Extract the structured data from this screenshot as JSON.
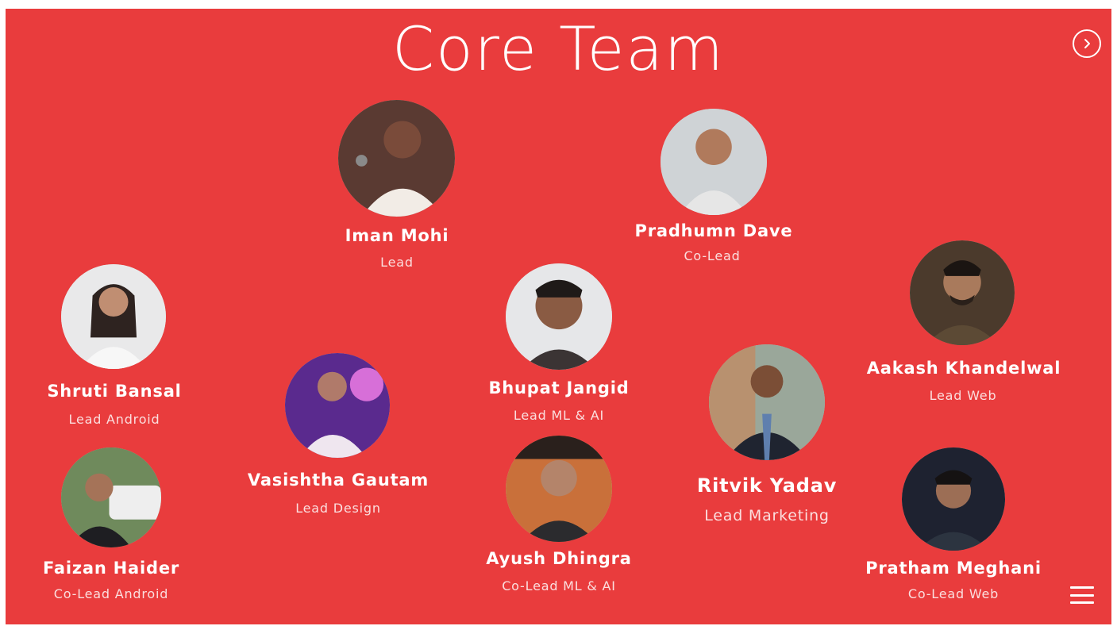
{
  "slide": {
    "title": "Core Team",
    "background_color": "#E93C3D",
    "next_icon": "chevron-right-icon",
    "menu_icon": "hamburger-menu-icon"
  },
  "members": [
    {
      "name": "Iman Mohi",
      "role": "Lead",
      "photo": "photo-woman-with-microphone"
    },
    {
      "name": "Pradhumn Dave",
      "role": "Co-Lead",
      "photo": "photo-man-light-shirt"
    },
    {
      "name": "Shruti Bansal",
      "role": "Lead Android",
      "photo": "photo-woman-white-shirt"
    },
    {
      "name": "Bhupat Jangid",
      "role": "Lead ML & AI",
      "photo": "photo-man-portrait"
    },
    {
      "name": "Aakash Khandelwal",
      "role": "Lead Web",
      "photo": "photo-man-glasses-beard"
    },
    {
      "name": "Vasishtha Gautam",
      "role": "Lead Design",
      "photo": "photo-man-purple-lights"
    },
    {
      "name": "Ritvik Yadav",
      "role": "Lead Marketing",
      "photo": "photo-man-suit"
    },
    {
      "name": "Faizan Haider",
      "role": "Co-Lead Android",
      "photo": "photo-man-by-car"
    },
    {
      "name": "Ayush Dhingra",
      "role": "Co-Lead ML & AI",
      "photo": "photo-man-glasses"
    },
    {
      "name": "Pratham Meghani",
      "role": "Co-Lead Web",
      "photo": "photo-man-night"
    }
  ]
}
